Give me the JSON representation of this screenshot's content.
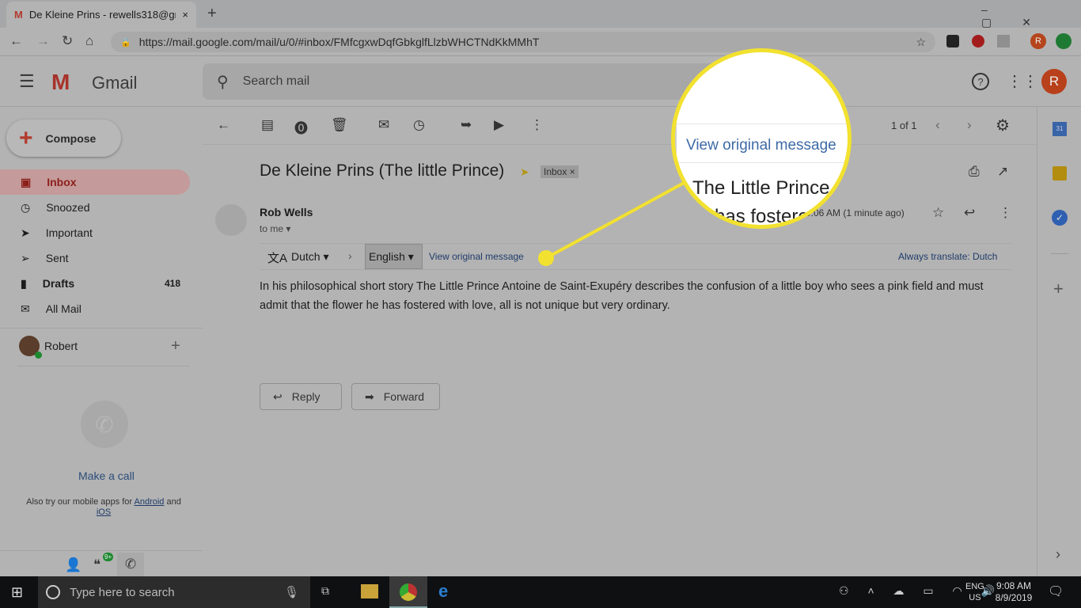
{
  "browser": {
    "tab_title": "De Kleine Prins - rewells318@gm",
    "url": "https://mail.google.com/mail/u/0/#inbox/FMfcgxwDqfGbkglfLlzbWHCTNdKkMMhT",
    "new_tab": "+",
    "close": "×",
    "profile_initial": "R"
  },
  "gmail": {
    "logo_text": "Gmail",
    "search_placeholder": "Search mail",
    "avatar_initial": "R"
  },
  "sidebar": {
    "compose": "Compose",
    "items": [
      {
        "label": "Inbox",
        "count": ""
      },
      {
        "label": "Snoozed",
        "count": ""
      },
      {
        "label": "Important",
        "count": ""
      },
      {
        "label": "Sent",
        "count": ""
      },
      {
        "label": "Drafts",
        "count": "418"
      },
      {
        "label": "All Mail",
        "count": ""
      }
    ],
    "hangouts_user": "Robert",
    "make_call": "Make a call",
    "mobile_text": "Also try our mobile apps for",
    "android": "Android",
    "and": "and",
    "ios": "iOS",
    "badge": "9+"
  },
  "toolbar": {
    "pagination": "1 of 1"
  },
  "message": {
    "subject": "De Kleine Prins (The little Prince)",
    "label": "Inbox",
    "sender": "Rob Wells",
    "to": "to me",
    "time": "9:06 AM (1 minute ago)",
    "translate": {
      "from": "Dutch",
      "to": "English",
      "view_original": "View original message",
      "always": "Always translate: Dutch"
    },
    "body": "In his philosophical short story The Little Prince Antoine de Saint-Exupéry describes the confusion of a little boy who sees a pink field and must admit that the flower he has fostered with love, all is not unique but very ordinary.",
    "reply": "Reply",
    "forward": "Forward"
  },
  "magnifier": {
    "link": "View original message",
    "line1": "The Little Prince",
    "line2": "has fostere",
    "color": "#f2e12f"
  },
  "taskbar": {
    "search_placeholder": "Type here to search",
    "lang": "ENG",
    "region": "US",
    "time": "9:08 AM",
    "date": "8/9/2019"
  }
}
